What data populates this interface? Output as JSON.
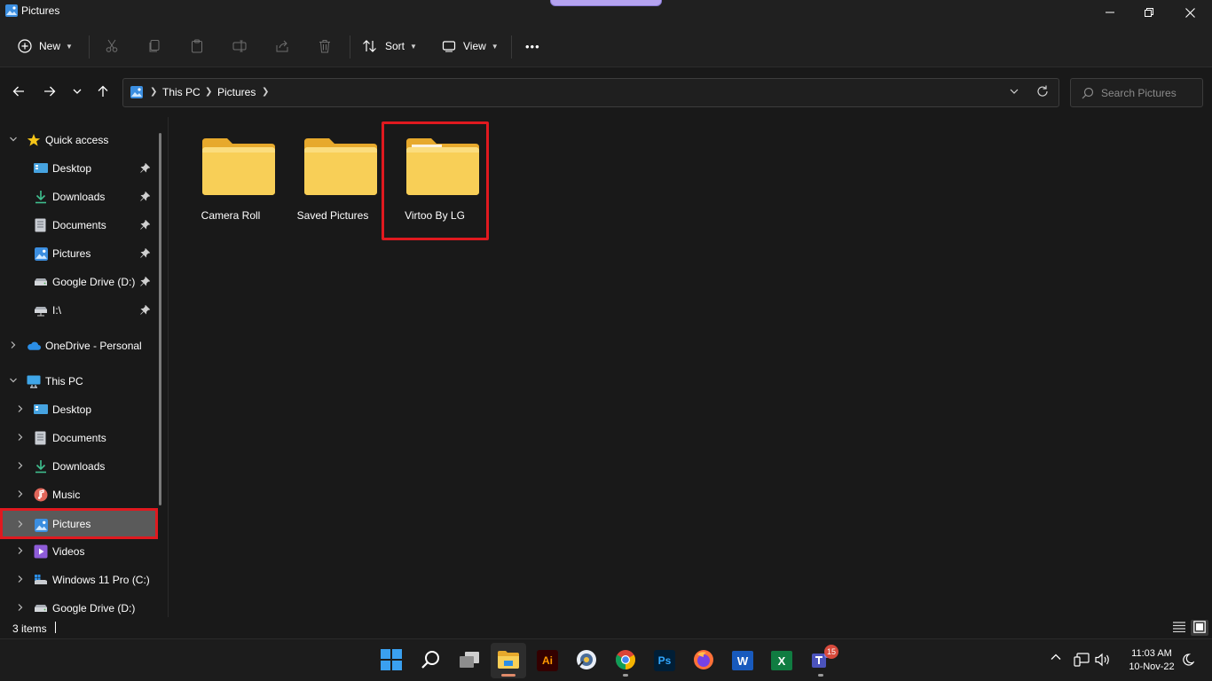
{
  "window": {
    "title": "Pictures",
    "controls": {
      "minimize": "—",
      "maximize": "❐",
      "close": "✕"
    }
  },
  "commandbar": {
    "new_label": "New",
    "sort_label": "Sort",
    "view_label": "View",
    "more_label": "•••"
  },
  "address": {
    "crumbs": [
      "This PC",
      "Pictures"
    ],
    "search_placeholder": "Search Pictures"
  },
  "sidebar": {
    "quick_access": {
      "label": "Quick access",
      "items": [
        {
          "label": "Desktop",
          "icon": "desktop-icon",
          "pinned": true
        },
        {
          "label": "Downloads",
          "icon": "download-icon",
          "pinned": true
        },
        {
          "label": "Documents",
          "icon": "document-icon",
          "pinned": true
        },
        {
          "label": "Pictures",
          "icon": "pictures-icon",
          "pinned": true
        },
        {
          "label": "Google Drive (D:)",
          "icon": "drive-icon",
          "pinned": true
        },
        {
          "label": "I:\\",
          "icon": "network-drive-icon",
          "pinned": true
        }
      ]
    },
    "onedrive": {
      "label": "OneDrive - Personal"
    },
    "this_pc": {
      "label": "This PC",
      "items": [
        {
          "label": "Desktop",
          "icon": "desktop-icon"
        },
        {
          "label": "Documents",
          "icon": "document-icon"
        },
        {
          "label": "Downloads",
          "icon": "download-icon"
        },
        {
          "label": "Music",
          "icon": "music-icon"
        },
        {
          "label": "Pictures",
          "icon": "pictures-icon",
          "selected": true
        },
        {
          "label": "Videos",
          "icon": "videos-icon"
        },
        {
          "label": "Windows 11 Pro (C:)",
          "icon": "system-drive-icon"
        },
        {
          "label": "Google Drive (D:)",
          "icon": "drive-icon"
        }
      ]
    }
  },
  "content": {
    "folders": [
      {
        "name": "Camera Roll"
      },
      {
        "name": "Saved Pictures"
      },
      {
        "name": "Virtoo By LG",
        "highlighted": true
      }
    ]
  },
  "status": {
    "count": "3 items"
  },
  "taskbar": {
    "apps": [
      "windows-start",
      "search",
      "task-view",
      "file-explorer",
      "adobe-illustrator",
      "media-app",
      "google-chrome",
      "adobe-photoshop",
      "firefox",
      "microsoft-word",
      "microsoft-excel",
      "teams"
    ],
    "teams_badge": "15",
    "illustrator_label": "Ai",
    "photoshop_label": "Ps",
    "word_label": "W",
    "excel_label": "X",
    "time": "11:03 AM",
    "date": "10-Nov-22"
  },
  "colors": {
    "background": "#191919",
    "chrome": "#202020",
    "folder": "#f5c94c",
    "highlight": "#e0191f",
    "selected_row": "#5a5a5a"
  }
}
